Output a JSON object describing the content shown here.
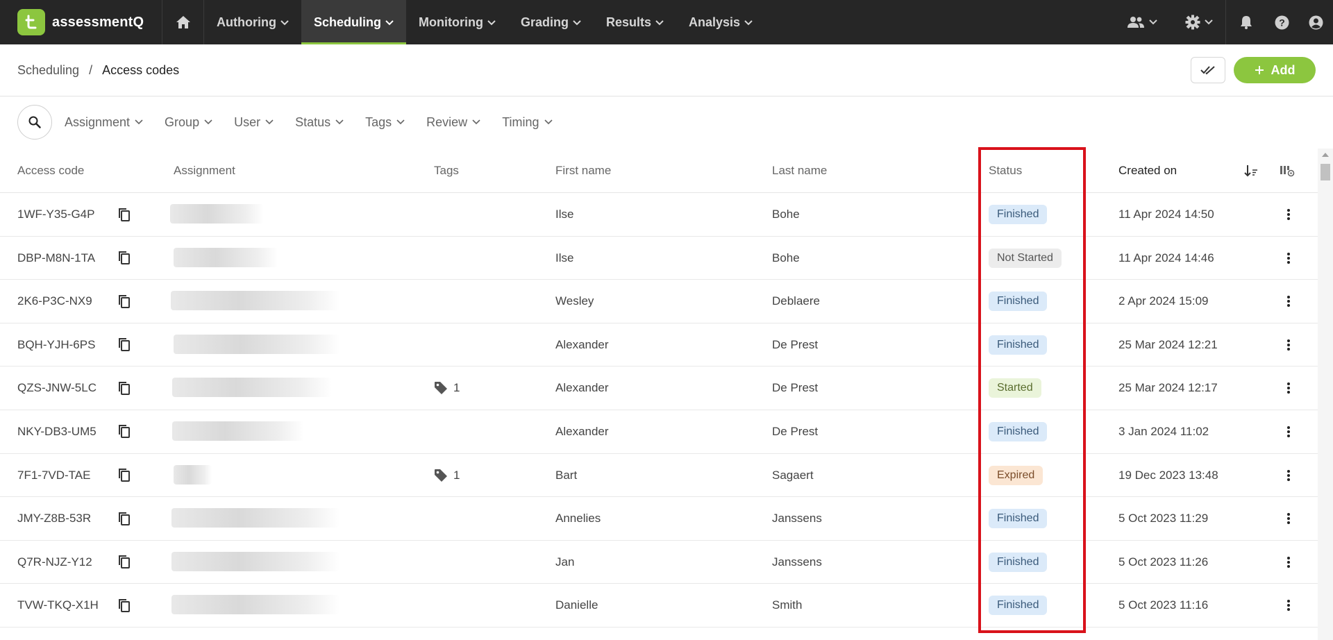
{
  "app": {
    "brand": "assessmentQ",
    "brand_color": "#8cc63f"
  },
  "nav": {
    "items": [
      {
        "label": "Authoring"
      },
      {
        "label": "Scheduling",
        "active": true
      },
      {
        "label": "Monitoring"
      },
      {
        "label": "Grading"
      },
      {
        "label": "Results"
      },
      {
        "label": "Analysis"
      }
    ]
  },
  "breadcrumb": {
    "parent": "Scheduling",
    "separator": "/",
    "current": "Access codes"
  },
  "actions": {
    "add_label": "Add"
  },
  "filters": [
    "Assignment",
    "Group",
    "User",
    "Status",
    "Tags",
    "Review",
    "Timing"
  ],
  "table": {
    "headers": {
      "access_code": "Access code",
      "assignment": "Assignment",
      "tags": "Tags",
      "first_name": "First name",
      "last_name": "Last name",
      "status": "Status",
      "created_on": "Created on"
    },
    "rows": [
      {
        "code": "1WF-Y35-G4P",
        "tags": "",
        "first": "Ilse",
        "last": "Bohe",
        "status": "Finished",
        "status_kind": "finished",
        "created": "11 Apr 2024 14:50"
      },
      {
        "code": "DBP-M8N-1TA",
        "tags": "",
        "first": "Ilse",
        "last": "Bohe",
        "status": "Not Started",
        "status_kind": "notstarted",
        "created": "11 Apr 2024 14:46"
      },
      {
        "code": "2K6-P3C-NX9",
        "tags": "",
        "first": "Wesley",
        "last": "Deblaere",
        "status": "Finished",
        "status_kind": "finished",
        "created": "2 Apr 2024 15:09"
      },
      {
        "code": "BQH-YJH-6PS",
        "tags": "",
        "first": "Alexander",
        "last": "De Prest",
        "status": "Finished",
        "status_kind": "finished",
        "created": "25 Mar 2024 12:21"
      },
      {
        "code": "QZS-JNW-5LC",
        "tags": "1",
        "first": "Alexander",
        "last": "De Prest",
        "status": "Started",
        "status_kind": "started",
        "created": "25 Mar 2024 12:17"
      },
      {
        "code": "NKY-DB3-UM5",
        "tags": "",
        "first": "Alexander",
        "last": "De Prest",
        "status": "Finished",
        "status_kind": "finished",
        "created": "3 Jan 2024 11:02"
      },
      {
        "code": "7F1-7VD-TAE",
        "tags": "1",
        "first": "Bart",
        "last": "Sagaert",
        "status": "Expired",
        "status_kind": "expired",
        "created": "19 Dec 2023 13:48"
      },
      {
        "code": "JMY-Z8B-53R",
        "tags": "",
        "first": "Annelies",
        "last": "Janssens",
        "status": "Finished",
        "status_kind": "finished",
        "created": "5 Oct 2023 11:29"
      },
      {
        "code": "Q7R-NJZ-Y12",
        "tags": "",
        "first": "Jan",
        "last": "Janssens",
        "status": "Finished",
        "status_kind": "finished",
        "created": "5 Oct 2023 11:26"
      },
      {
        "code": "TVW-TKQ-X1H",
        "tags": "",
        "first": "Danielle",
        "last": "Smith",
        "status": "Finished",
        "status_kind": "finished",
        "created": "5 Oct 2023 11:16"
      }
    ]
  }
}
